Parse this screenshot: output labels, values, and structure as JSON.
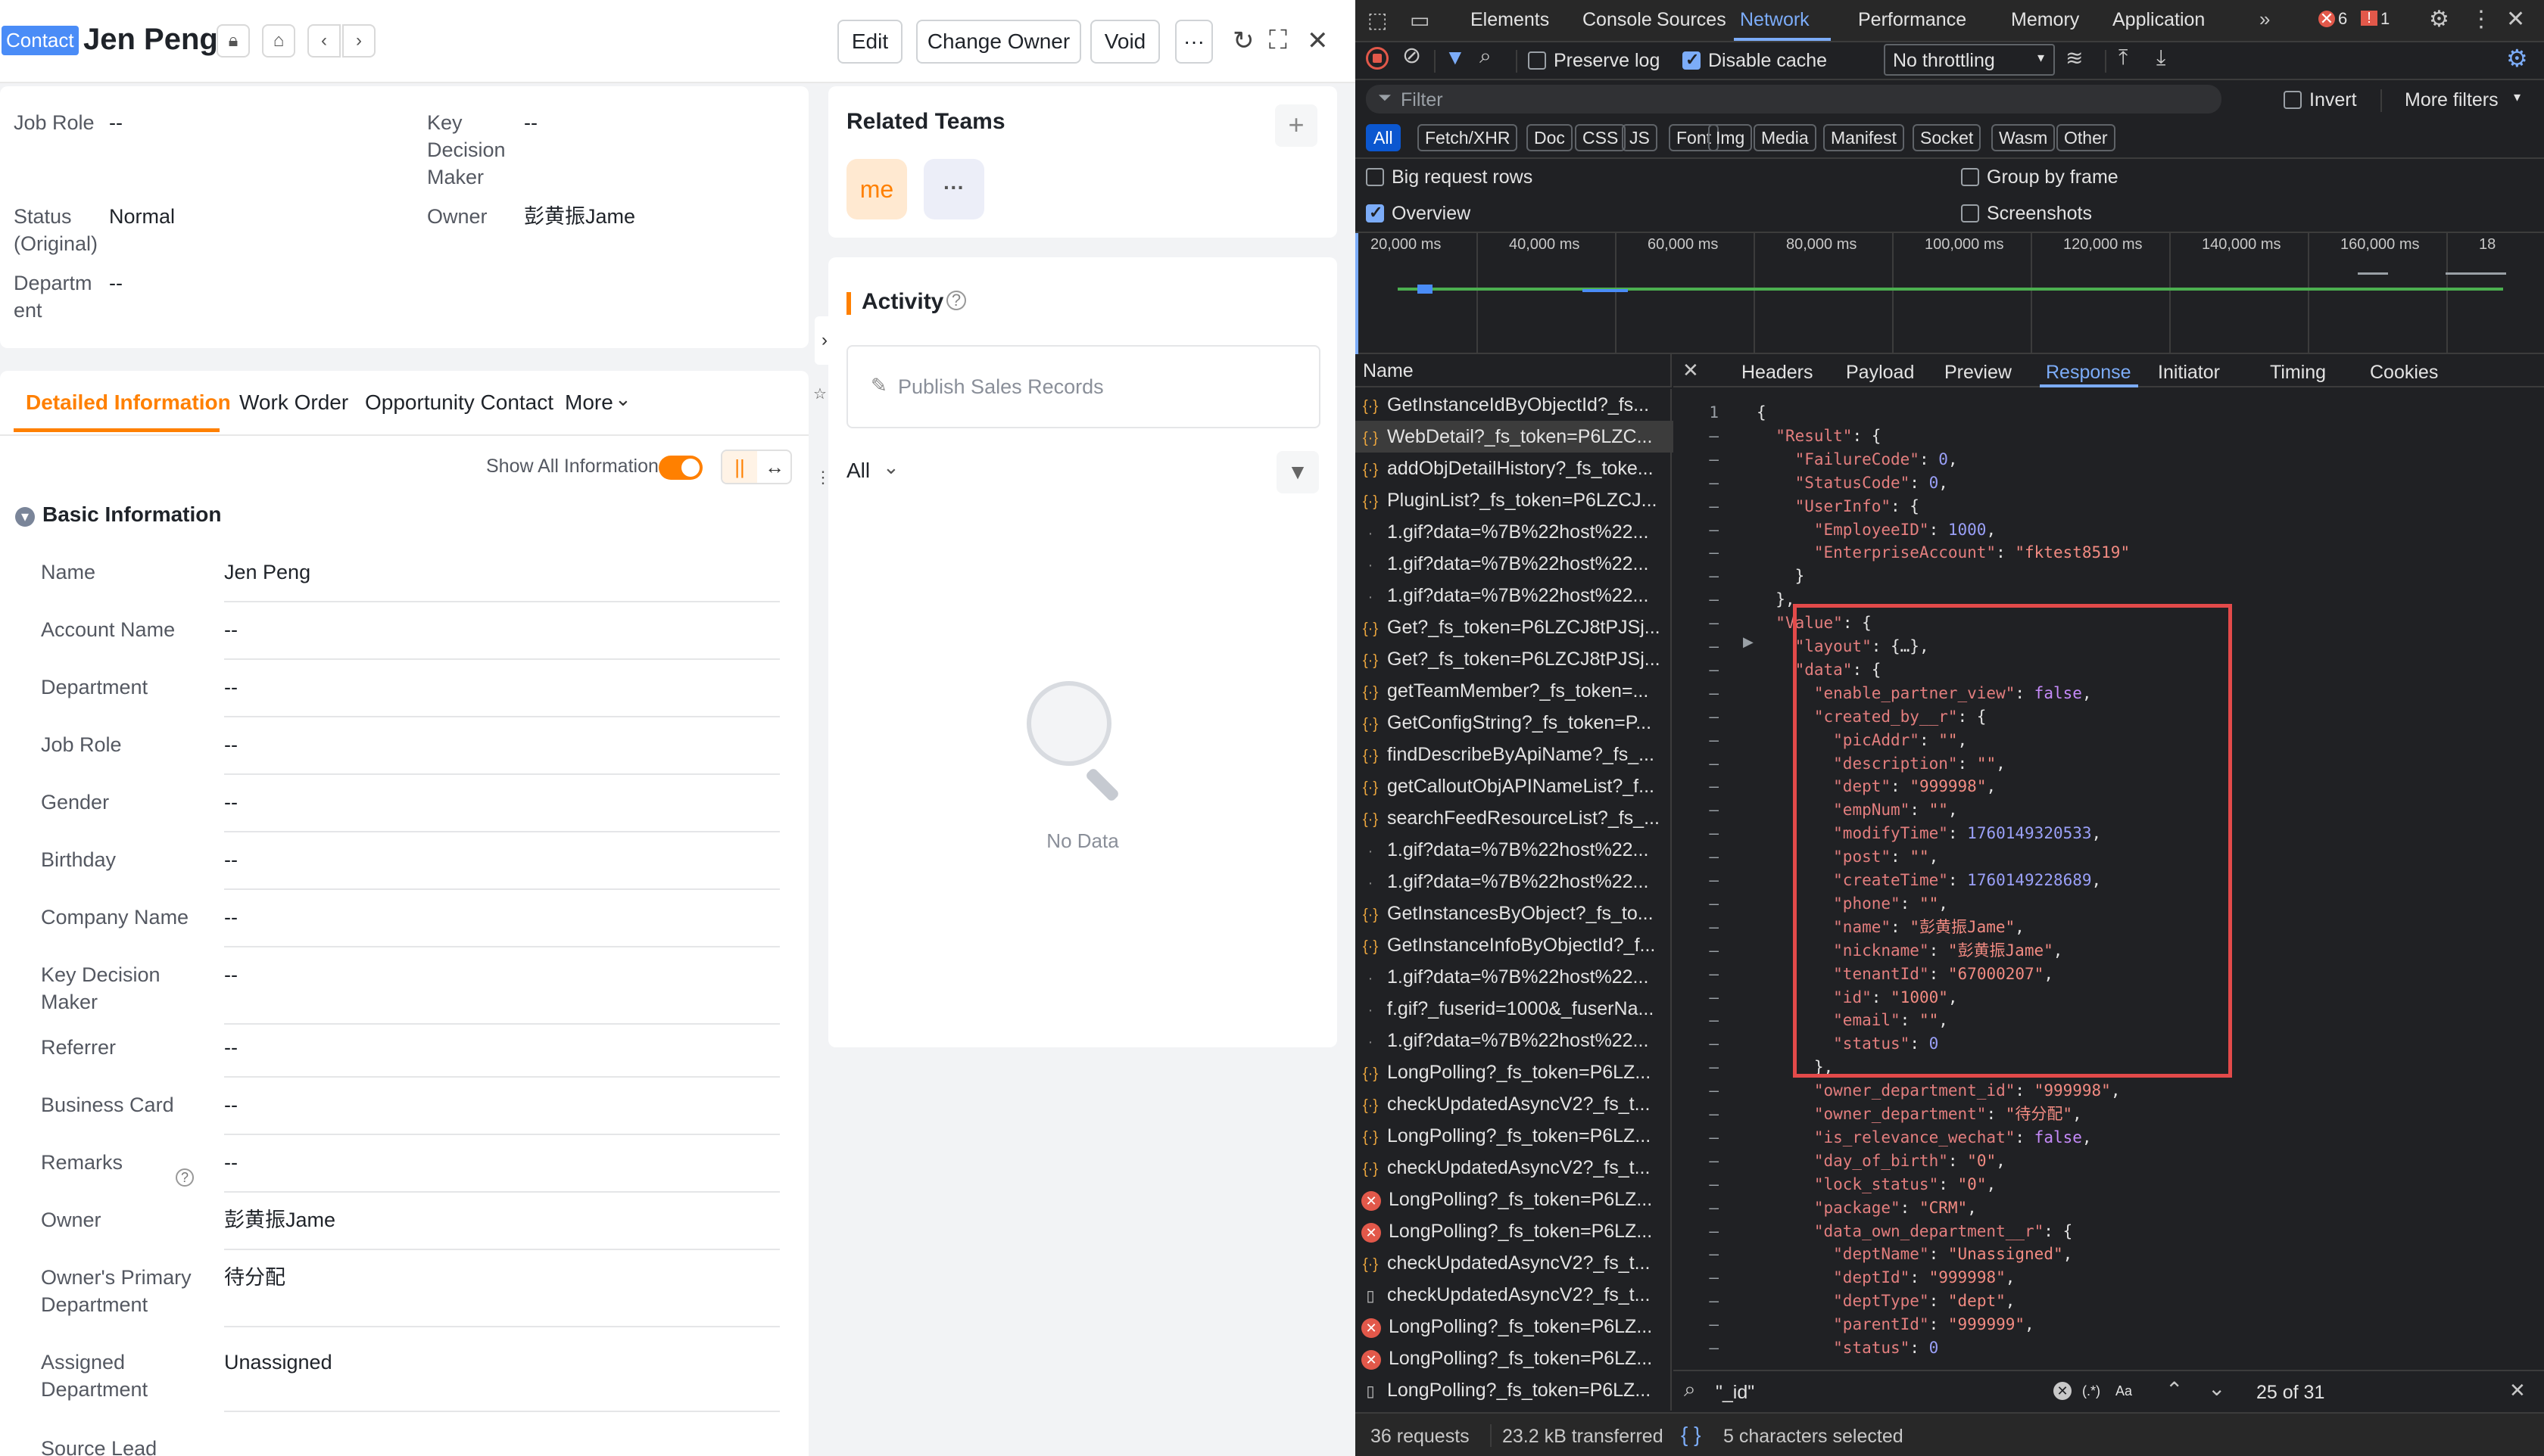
{
  "header": {
    "tag": "Contact",
    "title": "Jen Peng",
    "edit": "Edit",
    "change_owner": "Change Owner",
    "void": "Void",
    "more": "···"
  },
  "summary": {
    "job_role_label": "Job Role",
    "job_role": "--",
    "kdm_label": "Key Decision Maker",
    "kdm": "--",
    "status_label": "Status (Original)",
    "status": "Normal",
    "owner_label": "Owner",
    "owner": "彭黄振Jame",
    "dept_label": "Department",
    "dept": "--"
  },
  "tabs": {
    "detail": "Detailed Information",
    "work_order": "Work Order",
    "opp_contact": "Opportunity Contact",
    "more": "More"
  },
  "show_all": "Show All Information",
  "basic_info": "Basic Information",
  "fields": [
    {
      "k": "Name",
      "v": "Jen Peng"
    },
    {
      "k": "Account Name",
      "v": "--"
    },
    {
      "k": "Department",
      "v": "--"
    },
    {
      "k": "Job Role",
      "v": "--"
    },
    {
      "k": "Gender",
      "v": "--"
    },
    {
      "k": "Birthday",
      "v": "--"
    },
    {
      "k": "Company Name",
      "v": "--"
    },
    {
      "k": "Key Decision Maker",
      "v": "--"
    },
    {
      "k": "Referrer",
      "v": "--"
    },
    {
      "k": "Business Card",
      "v": "--"
    },
    {
      "k": "Remarks",
      "v": "--"
    },
    {
      "k": "Owner",
      "v": "彭黄振Jame"
    },
    {
      "k": "Owner's Primary Department",
      "v": "待分配"
    },
    {
      "k": "Assigned Department",
      "v": "Unassigned"
    },
    {
      "k": "Source Lead",
      "v": ""
    }
  ],
  "related": {
    "title": "Related Teams",
    "me": "me",
    "more": "···"
  },
  "activity": {
    "title": "Activity",
    "publish": "Publish Sales Records",
    "filter": "All",
    "empty": "No Data"
  },
  "devtools": {
    "tabs": [
      "Elements",
      "Console",
      "Sources",
      "Network",
      "Performance",
      "Memory",
      "Application"
    ],
    "errors": "6",
    "warnings": "1",
    "preserve_log": "Preserve log",
    "disable_cache": "Disable cache",
    "throttle": "No throttling",
    "filter_placeholder": "Filter",
    "invert": "Invert",
    "more_filters": "More filters",
    "types": [
      "All",
      "Fetch/XHR",
      "Doc",
      "CSS",
      "JS",
      "Font",
      "Img",
      "Media",
      "Manifest",
      "Socket",
      "Wasm",
      "Other"
    ],
    "big_rows": "Big request rows",
    "group_frame": "Group by frame",
    "overview": "Overview",
    "screenshots": "Screenshots",
    "timeline": [
      "20,000 ms",
      "40,000 ms",
      "60,000 ms",
      "80,000 ms",
      "100,000 ms",
      "120,000 ms",
      "140,000 ms",
      "160,000 ms",
      "18"
    ],
    "name_col": "Name",
    "detail_tabs": [
      "Headers",
      "Payload",
      "Preview",
      "Response",
      "Initiator",
      "Timing",
      "Cookies"
    ],
    "requests": [
      {
        "t": "xhr",
        "n": "GetInstanceIdByObjectId?_fs..."
      },
      {
        "t": "xhr",
        "n": "WebDetail?_fs_token=P6LZC..."
      },
      {
        "t": "xhr",
        "n": "addObjDetailHistory?_fs_toke..."
      },
      {
        "t": "xhr",
        "n": "PluginList?_fs_token=P6LZCJ..."
      },
      {
        "t": "img",
        "n": "1.gif?data=%7B%22host%22..."
      },
      {
        "t": "img",
        "n": "1.gif?data=%7B%22host%22..."
      },
      {
        "t": "img",
        "n": "1.gif?data=%7B%22host%22..."
      },
      {
        "t": "xhr",
        "n": "Get?_fs_token=P6LZCJ8tPJSj..."
      },
      {
        "t": "xhr",
        "n": "Get?_fs_token=P6LZCJ8tPJSj..."
      },
      {
        "t": "xhr",
        "n": "getTeamMember?_fs_token=..."
      },
      {
        "t": "xhr",
        "n": "GetConfigString?_fs_token=P..."
      },
      {
        "t": "xhr",
        "n": "findDescribeByApiName?_fs_..."
      },
      {
        "t": "xhr",
        "n": "getCalloutObjAPINameList?_f..."
      },
      {
        "t": "xhr",
        "n": "searchFeedResourceList?_fs_..."
      },
      {
        "t": "img",
        "n": "1.gif?data=%7B%22host%22..."
      },
      {
        "t": "img",
        "n": "1.gif?data=%7B%22host%22..."
      },
      {
        "t": "xhr",
        "n": "GetInstancesByObject?_fs_to..."
      },
      {
        "t": "xhr",
        "n": "GetInstanceInfoByObjectId?_f..."
      },
      {
        "t": "img",
        "n": "1.gif?data=%7B%22host%22..."
      },
      {
        "t": "img",
        "n": "f.gif?_fuserid=1000&_fuserNa..."
      },
      {
        "t": "img",
        "n": "1.gif?data=%7B%22host%22..."
      },
      {
        "t": "xhr",
        "n": "LongPolling?_fs_token=P6LZ..."
      },
      {
        "t": "xhr",
        "n": "checkUpdatedAsyncV2?_fs_t..."
      },
      {
        "t": "xhr",
        "n": "LongPolling?_fs_token=P6LZ..."
      },
      {
        "t": "xhr",
        "n": "checkUpdatedAsyncV2?_fs_t..."
      },
      {
        "t": "err",
        "n": "LongPolling?_fs_token=P6LZ..."
      },
      {
        "t": "err",
        "n": "LongPolling?_fs_token=P6LZ..."
      },
      {
        "t": "xhr",
        "n": "checkUpdatedAsyncV2?_fs_t..."
      },
      {
        "t": "doc",
        "n": "checkUpdatedAsyncV2?_fs_t..."
      },
      {
        "t": "err",
        "n": "LongPolling?_fs_token=P6LZ..."
      },
      {
        "t": "err",
        "n": "LongPolling?_fs_token=P6LZ..."
      },
      {
        "t": "doc",
        "n": "LongPolling?_fs_token=P6LZ..."
      }
    ],
    "code": [
      [
        "1",
        "{"
      ],
      [
        "–",
        "  \"Result\": {"
      ],
      [
        "–",
        "    \"FailureCode\": 0,"
      ],
      [
        "–",
        "    \"StatusCode\": 0,"
      ],
      [
        "–",
        "    \"UserInfo\": {"
      ],
      [
        "–",
        "      \"EmployeeID\": 1000,"
      ],
      [
        "–",
        "      \"EnterpriseAccount\": \"fktest8519\""
      ],
      [
        "–",
        "    }"
      ],
      [
        "–",
        "  },"
      ],
      [
        "–",
        "  \"Value\": {"
      ],
      [
        "–",
        "    \"layout\": {…},"
      ],
      [
        "–",
        "    \"data\": {"
      ],
      [
        "–",
        "      \"enable_partner_view\": false,"
      ],
      [
        "–",
        "      \"created_by__r\": {"
      ],
      [
        "–",
        "        \"picAddr\": \"\","
      ],
      [
        "–",
        "        \"description\": \"\","
      ],
      [
        "–",
        "        \"dept\": \"999998\","
      ],
      [
        "–",
        "        \"empNum\": \"\","
      ],
      [
        "–",
        "        \"modifyTime\": 1760149320533,"
      ],
      [
        "–",
        "        \"post\": \"\","
      ],
      [
        "–",
        "        \"createTime\": 1760149228689,"
      ],
      [
        "–",
        "        \"phone\": \"\","
      ],
      [
        "–",
        "        \"name\": \"彭黄振Jame\","
      ],
      [
        "–",
        "        \"nickname\": \"彭黄振Jame\","
      ],
      [
        "–",
        "        \"tenantId\": \"67000207\","
      ],
      [
        "–",
        "        \"id\": \"1000\","
      ],
      [
        "–",
        "        \"email\": \"\","
      ],
      [
        "–",
        "        \"status\": 0"
      ],
      [
        "–",
        "      },"
      ],
      [
        "–",
        "      \"owner_department_id\": \"999998\","
      ],
      [
        "–",
        "      \"owner_department\": \"待分配\","
      ],
      [
        "–",
        "      \"is_relevance_wechat\": false,"
      ],
      [
        "–",
        "      \"day_of_birth\": \"0\","
      ],
      [
        "–",
        "      \"lock_status\": \"0\","
      ],
      [
        "–",
        "      \"package\": \"CRM\","
      ],
      [
        "–",
        "      \"data_own_department__r\": {"
      ],
      [
        "–",
        "        \"deptName\": \"Unassigned\","
      ],
      [
        "–",
        "        \"deptId\": \"999998\","
      ],
      [
        "–",
        "        \"deptType\": \"dept\","
      ],
      [
        "–",
        "        \"parentId\": \"999999\","
      ],
      [
        "–",
        "        \"status\": 0"
      ],
      [
        "–",
        "      },"
      ]
    ],
    "search_value": "\"_id\"",
    "search_count": "25 of 31",
    "aa": "Aa",
    "regex": "(.*)",
    "status_requests": "36 requests",
    "status_transferred": "23.2 kB transferred",
    "selected": "5 characters selected"
  },
  "colors": {
    "accent": "#ff8000",
    "tag": "#4a8cf7",
    "highlight": "#e34a4a",
    "devtools_bg": "#202124",
    "link_blue": "#7cacf8"
  }
}
